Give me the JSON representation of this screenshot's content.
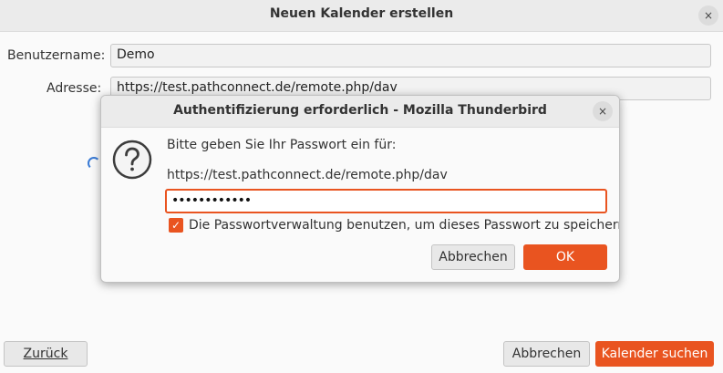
{
  "window": {
    "title": "Neuen Kalender erstellen",
    "close_glyph": "×"
  },
  "form": {
    "username_label": "Benutzername:",
    "username_value": "Demo",
    "address_label": "Adresse:",
    "address_value": "https://test.pathconnect.de/remote.php/dav"
  },
  "footer": {
    "back_label": "Zurück",
    "cancel_label": "Abbrechen",
    "search_label": "Kalender suchen"
  },
  "dialog": {
    "title": "Authentifizierung erforderlich - Mozilla Thunderbird",
    "close_glyph": "×",
    "prompt": "Bitte geben Sie Ihr Passwort ein für:",
    "url": "https://test.pathconnect.de/remote.php/dav",
    "password_masked": "••••••••••••",
    "checkbox_label": "Die Passwortverwaltung benutzen, um dieses Passwort zu speichern.",
    "checkbox_checked": true,
    "checkbox_glyph": "✓",
    "cancel_label": "Abbrechen",
    "ok_label": "OK",
    "icon": "question-icon"
  },
  "colors": {
    "accent": "#e95420",
    "spinner": "#3a7bd5"
  }
}
